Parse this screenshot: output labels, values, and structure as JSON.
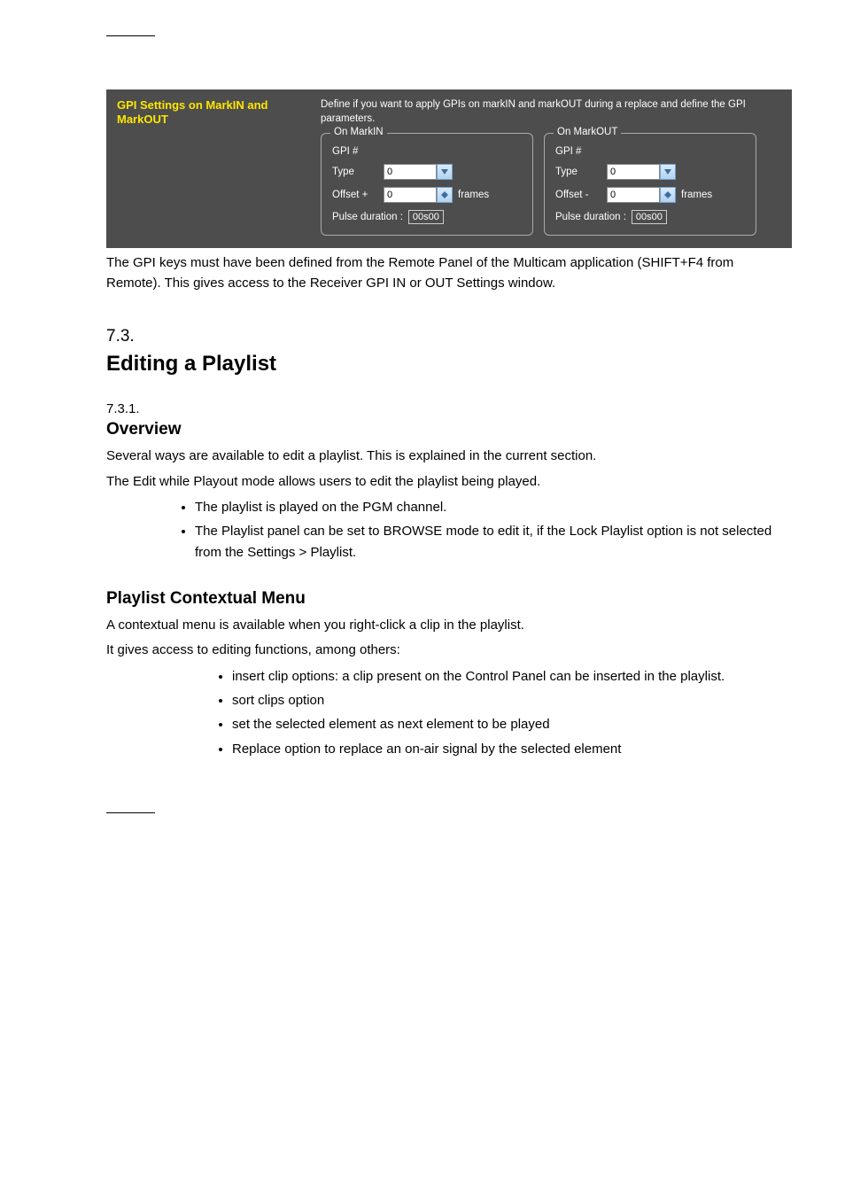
{
  "panel": {
    "title": "GPI Settings on MarkIN and MarkOUT",
    "description": "Define if you want to apply GPIs on markIN and markOUT during a replace and define the GPI parameters.",
    "groups": {
      "markin": {
        "legend": "On MarkIN",
        "gpi_label": "GPI #",
        "type_label": "Type",
        "type_value": "0",
        "offset_label": "Offset +",
        "offset_value": "0",
        "offset_unit": "frames",
        "pulse_label": "Pulse duration :",
        "pulse_value": "00s00"
      },
      "markout": {
        "legend": "On MarkOUT",
        "gpi_label": "GPI #",
        "type_label": "Type",
        "type_value": "0",
        "offset_label": "Offset -",
        "offset_value": "0",
        "offset_unit": "frames",
        "pulse_label": "Pulse duration :",
        "pulse_value": "00s00"
      }
    }
  },
  "text": {
    "below_panel": "The GPI keys must have been defined from the Remote Panel of the Multicam application (SHIFT+F4 from Remote). This gives access to the Receiver GPI IN or OUT Settings window.",
    "sec_num": "7.3.",
    "h2": "Editing a Playlist",
    "subnum": "7.3.1.",
    "h3_1": "Overview",
    "p1": "Several ways are available to edit a playlist. This is explained in the current section.",
    "p2": "The Edit while Playout mode allows users to edit the playlist being played.",
    "bul1_item1": "The playlist is played on the PGM channel.",
    "bul1_item2": "The Playlist panel can be set to BROWSE mode to edit it, if the Lock Playlist option is not selected from the ",
    "bul1_item2_link": "Settings > Playlist",
    "bul1_item2_after": ".",
    "h3_2": "Playlist Contextual Menu",
    "p3": "A contextual menu is available when you right-click a clip in the playlist.",
    "p4": "It gives access to editing functions, among others:",
    "bul2_item1": "insert clip options: a clip present on the Control Panel can be inserted in the playlist.",
    "bul2_item2": "sort clips option",
    "bul2_item3": "set the selected element as next element to be played",
    "bul2_item4": "Replace option to replace an on-air signal by the selected element"
  }
}
